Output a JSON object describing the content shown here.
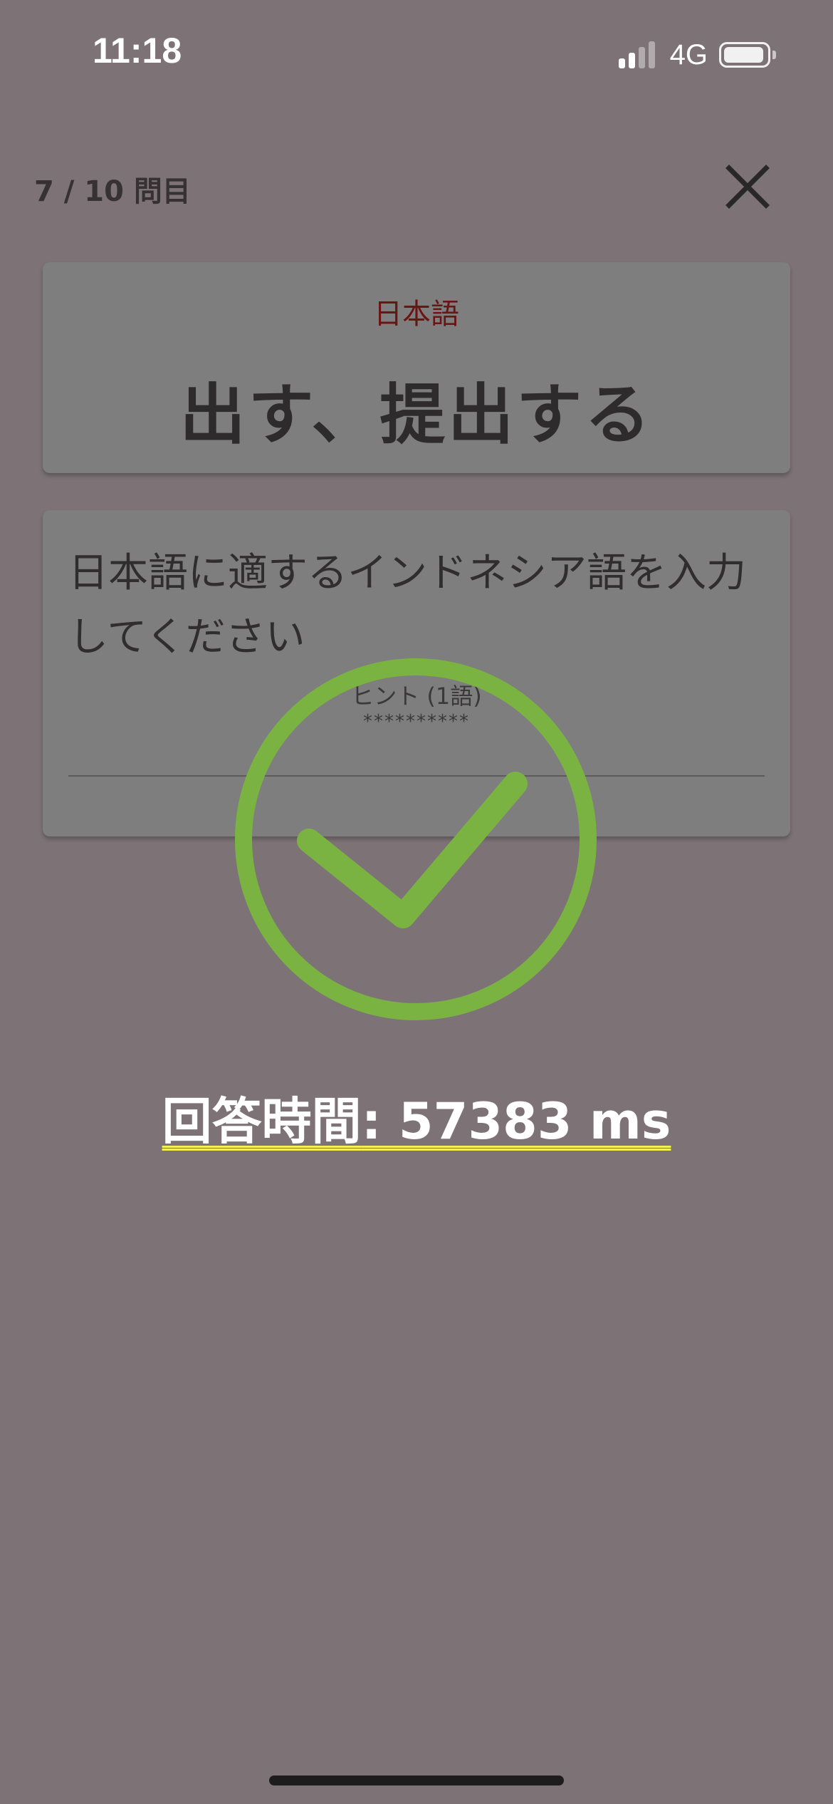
{
  "status_bar": {
    "time": "11:18",
    "network": "4G",
    "signal_bars_filled": 2,
    "signal_bars_total": 4,
    "battery_level": 0.95
  },
  "header": {
    "progress": "7 / 10 問目",
    "close_icon": "close-icon"
  },
  "word_card": {
    "label": "日本語",
    "term": "出す、提出する"
  },
  "question_card": {
    "instruction": "日本語に適するインドネシア語を入力してください",
    "hint_label": "ヒント (1語)",
    "hint_mask": "**********"
  },
  "result": {
    "icon": "check-circle-icon",
    "response_time_label": "回答時間",
    "response_time_value": ": 57383 ms"
  },
  "colors": {
    "background": "#7d7377",
    "check": "#7ab342",
    "label_accent": "#6b1414",
    "underline": "#f4ef52"
  }
}
